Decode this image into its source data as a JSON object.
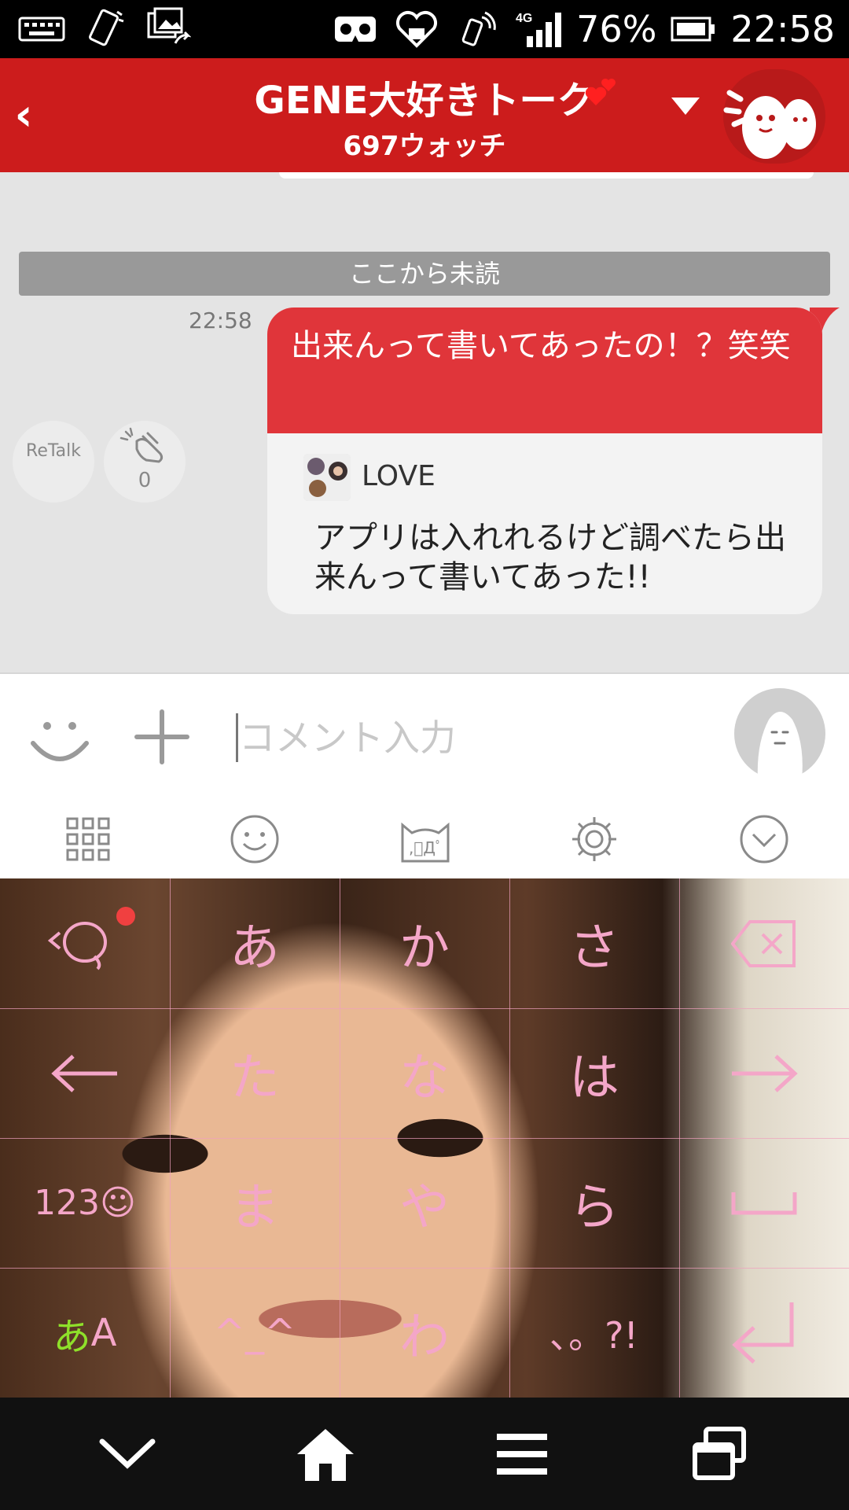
{
  "status_bar": {
    "battery_percent": "76%",
    "time": "22:58",
    "network": "4G"
  },
  "header": {
    "back_label": "‹",
    "title": "GENE大好きトーク",
    "subtitle": "697ウォッチ"
  },
  "chat": {
    "unread_divider": "ここから未読",
    "message": {
      "time": "22:58",
      "text": "出来んって書いてあったの！？笑笑",
      "quoted_user": "LOVE",
      "quoted_text": "アプリは入れれるけど調べたら出来んって書いてあった!!"
    },
    "retalk_label": "ReTalk",
    "clap_count": "0"
  },
  "input": {
    "placeholder": "コメント入力"
  },
  "keyboard": {
    "rows": [
      [
        "",
        "あ",
        "か",
        "さ",
        ""
      ],
      [
        "",
        "た",
        "な",
        "は",
        ""
      ],
      [
        "123☺",
        "ま",
        "や",
        "ら",
        ""
      ],
      [
        "あA",
        "^_^",
        "わ",
        "､。?!",
        ""
      ]
    ],
    "mode_hiragana": "あ",
    "mode_latin": "A",
    "key_color": "#f4a6c8"
  },
  "colors": {
    "header_red": "#cc1c1c",
    "bubble_red": "#e0353a",
    "status_black": "#000000"
  }
}
